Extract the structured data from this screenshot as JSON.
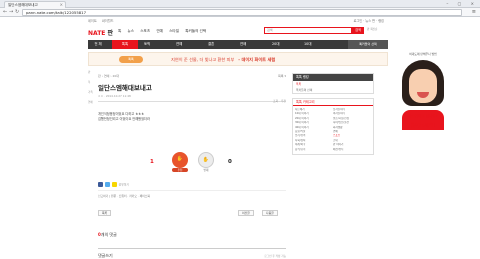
{
  "browser": {
    "tab_title": "일단스엠해대보내고",
    "url": "pann.nate.com/talk/122055817",
    "close": "×",
    "window_controls": "– ▢ ×"
  },
  "gnb": {
    "links": [
      "네이트",
      "싸이월드"
    ],
    "right": "로그인 · 뉴스 판 · 랭킹"
  },
  "header": {
    "logo_main": "NATE",
    "logo_sub": "판",
    "menu": [
      "톡",
      "뉴스",
      "스포츠",
      "연예",
      "스타일",
      "톡커들의 선택"
    ],
    "search_placeholder": "검색",
    "search_button": "검색",
    "search_side": "판 최신순"
  },
  "category_bar": {
    "home": "전 체",
    "items": [
      "톡톡",
      "토픽",
      "연예",
      "결혼",
      "연애",
      "20대",
      "10대"
    ],
    "right": "톡커들의 선택"
  },
  "banner": {
    "chip": "톡톡",
    "text": "지연이 준 선물, 더 빛나고 환한 피부",
    "text_bold": "- 데이지 화이트 세럼"
  },
  "left_mini": [
    "판",
    "톡",
    "가족",
    "연애"
  ],
  "post": {
    "crumbs": "판 › 연예 › 20대",
    "list_label": "목록 ▾",
    "title": "일단스엠해대보내고",
    "meta_left": "ㅇㅇ · 2014.10.27 11:48",
    "meta_right": "조회 · 추천",
    "body": [
      "개인석정용정이었요 다하고 ㅎㅎㅎ",
      "김했던정인리고 이었이요 안해봤었더라"
    ],
    "votes_up": "1",
    "votes_down": "0",
    "up_label": "추천",
    "down_label": "반대",
    "share_label": "공유하기",
    "origin": "신고하기 | 원문 · 트위터 · 카카오 · 페이스북",
    "buttons": [
      "목록",
      "이전글",
      "다음글"
    ],
    "comments_count_label": "0",
    "comments_label": "개의 댓글",
    "comments_heading": "댓글쓰기",
    "comments_right": "로그인 후 작성 가능"
  },
  "sidebar": {
    "box1_head": "톡톡 랭킹",
    "box1_items": [
      "톡톡",
      "톡커들의 선택"
    ],
    "box2_head": "톡톡 카테고리",
    "grid": [
      "사는얘기",
      "남자들끼리",
      "10대 이야기",
      "여자들끼리",
      "20대 이야기",
      "결혼/시집/친정",
      "30대 이야기",
      "육아/임신/출산",
      "40대 이야기",
      "회사생활",
      "동물/식물",
      "연예",
      "엽기/유머",
      "스포츠",
      "사회/정치",
      "군대",
      "세계/외국",
      "판 이야기",
      "음식/요리",
      "패션/뷰티"
    ],
    "grid_red_index": 13
  },
  "ad": {
    "top": "비대도에 만해우나 방법",
    "q1": "하소연하고 싶나요?",
    "q2": "물어보세요!"
  },
  "colors": {
    "accent": "#e8141d",
    "dark_bar": "#3a3a3a",
    "banner_bg": "#fdf5ec"
  }
}
